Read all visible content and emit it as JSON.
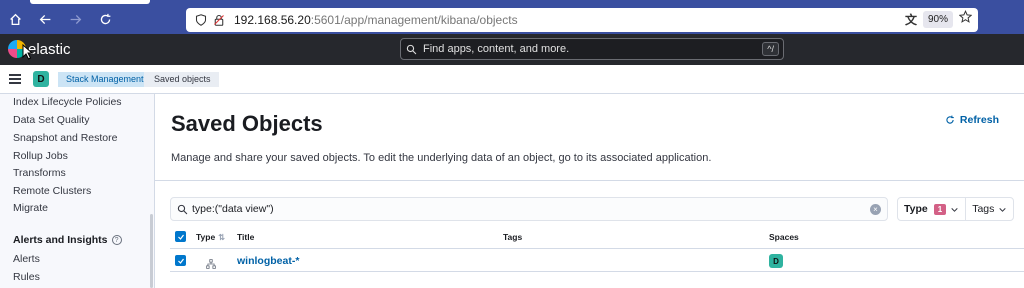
{
  "browser": {
    "url_host": "192.168.56.20",
    "url_rest": ":5601/app/management/kibana/objects",
    "zoom": "90%"
  },
  "header": {
    "logo_text": "elastic",
    "search_placeholder": "Find apps, content, and more.",
    "shortcut": "^/"
  },
  "breadcrumbs": {
    "space_initial": "D",
    "items": [
      "Stack Management",
      "Saved objects"
    ]
  },
  "sidebar": {
    "items": [
      "Index Lifecycle Policies",
      "Data Set Quality",
      "Snapshot and Restore",
      "Rollup Jobs",
      "Transforms",
      "Remote Clusters",
      "Migrate"
    ],
    "section": "Alerts and Insights",
    "section_items": [
      "Alerts",
      "Rules"
    ]
  },
  "main": {
    "title": "Saved Objects",
    "refresh_label": "Refresh",
    "description": "Manage and share your saved objects. To edit the underlying data of an object, go to its associated application.",
    "query": "type:(\"data view\")",
    "filter_type_label": "Type",
    "filter_type_count": "1",
    "filter_tags_label": "Tags",
    "columns": {
      "type": "Type",
      "title": "Title",
      "tags": "Tags",
      "spaces": "Spaces"
    },
    "rows": [
      {
        "title": "winlogbeat-*",
        "space": "D",
        "checked": true
      }
    ]
  },
  "colors": {
    "accent": "#0077cc",
    "link": "#0061a6",
    "space_badge": "#2fb3a0",
    "type_count_badge": "#d36086"
  }
}
